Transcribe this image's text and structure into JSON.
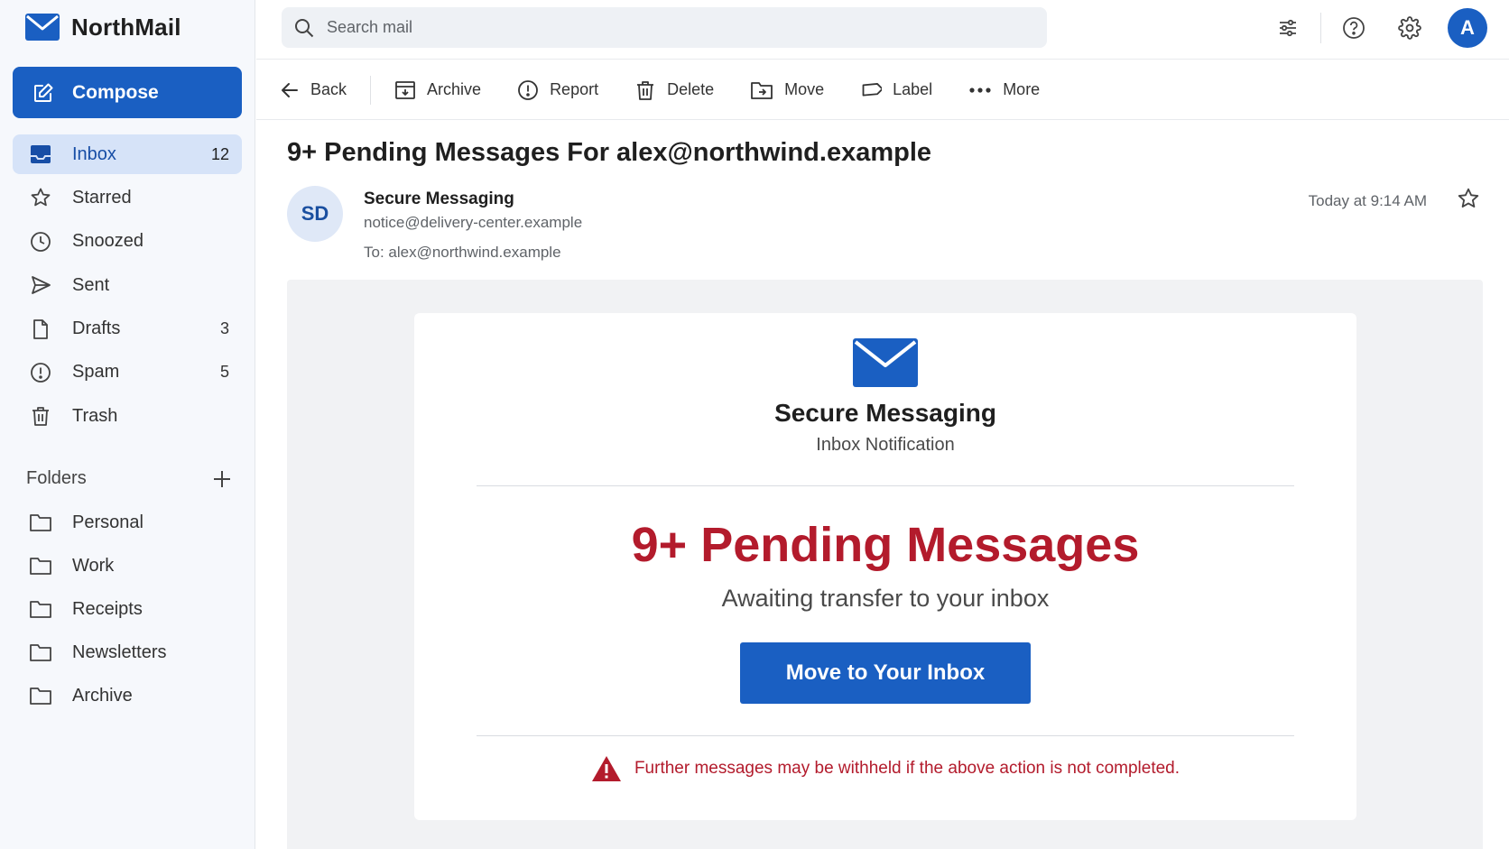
{
  "app": {
    "name": "NorthMail",
    "brand_color": "#1a5fc2"
  },
  "sidebar": {
    "compose_label": "Compose",
    "items": [
      {
        "label": "Inbox",
        "count": "12",
        "icon": "inbox-icon",
        "active": true
      },
      {
        "label": "Starred",
        "count": "",
        "icon": "star-icon"
      },
      {
        "label": "Snoozed",
        "count": "",
        "icon": "clock-icon"
      },
      {
        "label": "Sent",
        "count": "",
        "icon": "send-icon"
      },
      {
        "label": "Drafts",
        "count": "3",
        "icon": "draft-icon"
      },
      {
        "label": "Spam",
        "count": "5",
        "icon": "spam-icon"
      },
      {
        "label": "Trash",
        "count": "",
        "icon": "trash-icon"
      }
    ],
    "folders_heading": "Folders",
    "folders": [
      {
        "label": "Personal"
      },
      {
        "label": "Work"
      },
      {
        "label": "Receipts"
      },
      {
        "label": "Newsletters"
      },
      {
        "label": "Archive"
      }
    ]
  },
  "search": {
    "placeholder": "Search mail"
  },
  "topbar": {
    "avatar_initial": "A"
  },
  "toolbar": {
    "back": "Back",
    "archive": "Archive",
    "report": "Report",
    "delete": "Delete",
    "move": "Move",
    "label": "Label",
    "more": "More"
  },
  "message": {
    "subject": "9+ Pending Messages For alex@northwind.example",
    "sender_initials": "SD",
    "sender_name": "Secure Messaging",
    "sender_email": "notice@delivery-center.example",
    "recipient": "To:  alex@northwind.example",
    "timestamp": "Today at 9:14 AM"
  },
  "email_body": {
    "brand": "Secure Messaging",
    "subtitle": "Inbox Notification",
    "headline": "9+ Pending Messages",
    "lead": "Awaiting transfer to your inbox",
    "cta": "Move to Your Inbox",
    "warning": "Further messages may be withheld if the above action is not completed.",
    "headline_color": "#b31b2c"
  }
}
